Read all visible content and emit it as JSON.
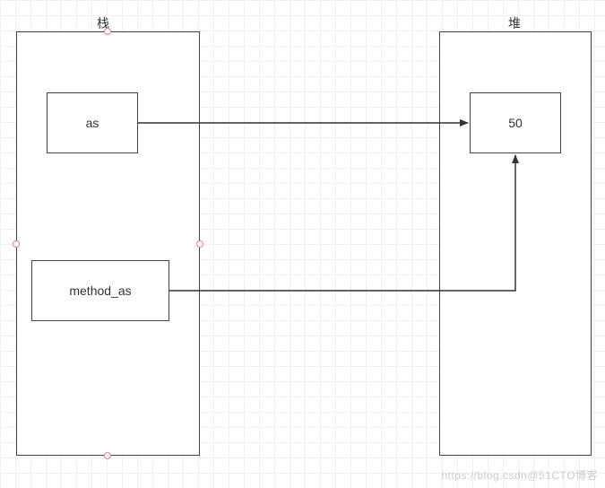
{
  "labels": {
    "stack": "栈",
    "heap": "堆"
  },
  "boxes": {
    "as": "as",
    "method_as": "method_as",
    "fifty": "50"
  },
  "watermark": "https://blog.csdn@51CTO博客"
}
